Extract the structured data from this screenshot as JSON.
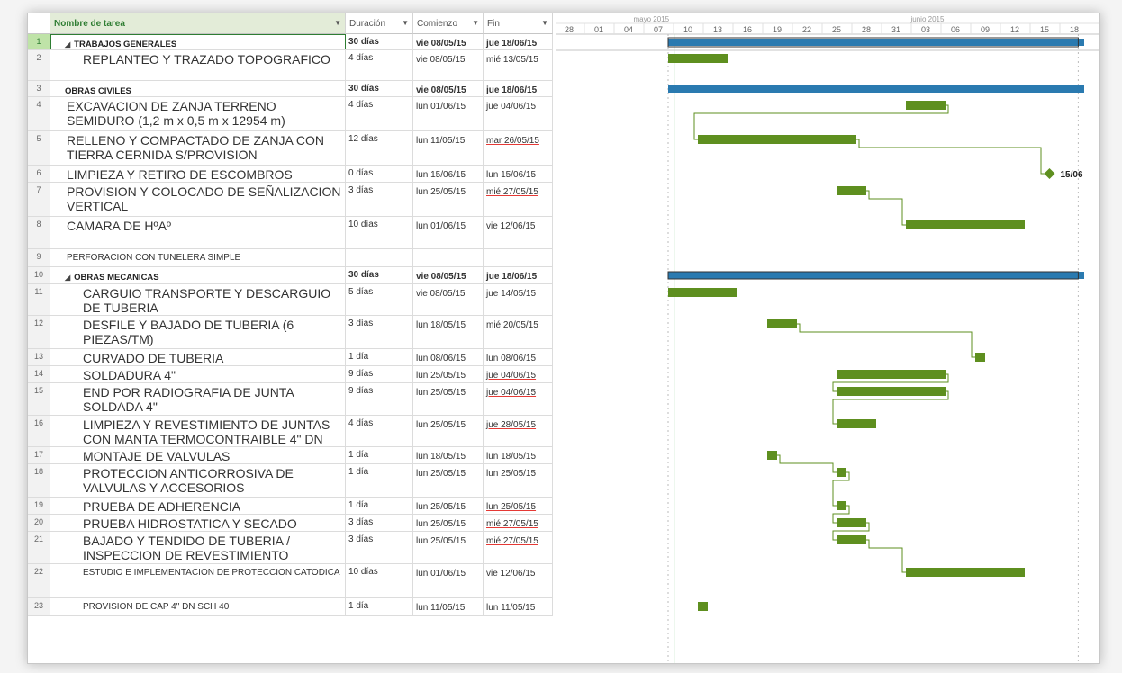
{
  "columns": {
    "name": "Nombre de tarea",
    "duration": "Duración",
    "start": "Comienzo",
    "end": "Fin"
  },
  "timescale": {
    "months": [
      "mayo 2015",
      "junio 2015"
    ],
    "days": [
      "28",
      "01",
      "04",
      "07",
      "10",
      "13",
      "16",
      "19",
      "22",
      "25",
      "28",
      "31",
      "03",
      "06",
      "09",
      "12",
      "15",
      "18"
    ]
  },
  "tasks": [
    {
      "id": "1",
      "name": "TRABAJOS GENERALES",
      "summary": true,
      "level": 0,
      "duration": "30 días",
      "start": "vie 08/05/15",
      "end": "jue 18/06/15"
    },
    {
      "id": "2",
      "name": "REPLANTEO Y TRAZADO TOPOGRAFICO",
      "level": 2,
      "duration": "4 días",
      "start": "vie 08/05/15",
      "end": "mié 13/05/15"
    },
    {
      "id": "3",
      "name": "OBRAS CIVILES",
      "summary": true,
      "level": 0,
      "duration": "30 días",
      "start": "vie 08/05/15",
      "end": "jue 18/06/15"
    },
    {
      "id": "4",
      "name": "EXCAVACION DE ZANJA TERRENO SEMIDURO (1,2 m x 0,5 m x 12954 m)",
      "level": 1,
      "duration": "4 días",
      "start": "lun 01/06/15",
      "end": "jue 04/06/15"
    },
    {
      "id": "5",
      "name": "RELLENO Y COMPACTADO DE ZANJA CON TIERRA CERNIDA S/PROVISION",
      "level": 1,
      "duration": "12 días",
      "start": "lun 11/05/15",
      "end": "mar 26/05/15"
    },
    {
      "id": "6",
      "name": "LIMPIEZA Y RETIRO DE ESCOMBROS",
      "level": 1,
      "duration": "0 días",
      "start": "lun 15/06/15",
      "end": "lun 15/06/15"
    },
    {
      "id": "7",
      "name": "PROVISION Y COLOCADO DE SEÑALIZACION VERTICAL",
      "level": 1,
      "duration": "3 días",
      "start": "lun 25/05/15",
      "end": "mié 27/05/15"
    },
    {
      "id": "8",
      "name": "CAMARA DE HºAº",
      "level": 1,
      "duration": "10 días",
      "start": "lun 01/06/15",
      "end": "vie 12/06/15"
    },
    {
      "id": "9",
      "name": "PERFORACION CON TUNELERA SIMPLE",
      "level": 1,
      "small": true,
      "duration": "",
      "start": "",
      "end": ""
    },
    {
      "id": "10",
      "name": "OBRAS MECANICAS",
      "summary": true,
      "level": 0,
      "duration": "30 días",
      "start": "vie 08/05/15",
      "end": "jue 18/06/15"
    },
    {
      "id": "11",
      "name": "CARGUIO TRANSPORTE Y DESCARGUIO DE TUBERIA",
      "level": 2,
      "duration": "5 días",
      "start": "vie 08/05/15",
      "end": "jue 14/05/15"
    },
    {
      "id": "12",
      "name": "DESFILE Y BAJADO DE TUBERIA (6 PIEZAS/TM)",
      "level": 2,
      "duration": "3 días",
      "start": "lun 18/05/15",
      "end": "mié 20/05/15"
    },
    {
      "id": "13",
      "name": "CURVADO DE TUBERIA",
      "level": 2,
      "duration": "1 día",
      "start": "lun 08/06/15",
      "end": "lun 08/06/15"
    },
    {
      "id": "14",
      "name": "SOLDADURA 4\"",
      "level": 2,
      "duration": "9 días",
      "start": "lun 25/05/15",
      "end": "jue 04/06/15"
    },
    {
      "id": "15",
      "name": "END POR RADIOGRAFIA DE JUNTA SOLDADA 4\"",
      "level": 2,
      "duration": "9 días",
      "start": "lun 25/05/15",
      "end": "jue 04/06/15"
    },
    {
      "id": "16",
      "name": "LIMPIEZA Y REVESTIMIENTO DE JUNTAS CON MANTA TERMOCONTRAIBLE 4\" DN",
      "level": 2,
      "duration": "4 días",
      "start": "lun 25/05/15",
      "end": "jue 28/05/15"
    },
    {
      "id": "17",
      "name": "MONTAJE DE VALVULAS",
      "level": 2,
      "duration": "1 día",
      "start": "lun 18/05/15",
      "end": "lun 18/05/15"
    },
    {
      "id": "18",
      "name": "PROTECCION ANTICORROSIVA DE VALVULAS Y ACCESORIOS",
      "level": 2,
      "duration": "1 día",
      "start": "lun 25/05/15",
      "end": "lun 25/05/15"
    },
    {
      "id": "19",
      "name": "PRUEBA DE ADHERENCIA",
      "level": 2,
      "duration": "1 día",
      "start": "lun 25/05/15",
      "end": "lun 25/05/15"
    },
    {
      "id": "20",
      "name": "PRUEBA HIDROSTATICA Y SECADO",
      "level": 2,
      "duration": "3 días",
      "start": "lun 25/05/15",
      "end": "mié 27/05/15"
    },
    {
      "id": "21",
      "name": "BAJADO Y TENDIDO DE TUBERIA / INSPECCION DE REVESTIMIENTO",
      "level": 2,
      "duration": "3 días",
      "start": "lun 25/05/15",
      "end": "mié 27/05/15"
    },
    {
      "id": "22",
      "name": "ESTUDIO E IMPLEMENTACION DE PROTECCION CATODICA",
      "level": 2,
      "small": true,
      "duration": "10 días",
      "start": "lun 01/06/15",
      "end": "vie 12/06/15"
    },
    {
      "id": "23",
      "name": "PROVISION DE CAP 4\" DN SCH 40",
      "level": 2,
      "small": true,
      "duration": "1 día",
      "start": "lun 11/05/15",
      "end": "lun 11/05/15"
    }
  ],
  "milestone_label": "15/06",
  "colors": {
    "summary_bar": "#2a7ab0",
    "task_bar": "#5e8f1f",
    "link": "#5e8f1f",
    "today_line": "#a5d6a7",
    "header_highlight": "#2e7d32"
  }
}
